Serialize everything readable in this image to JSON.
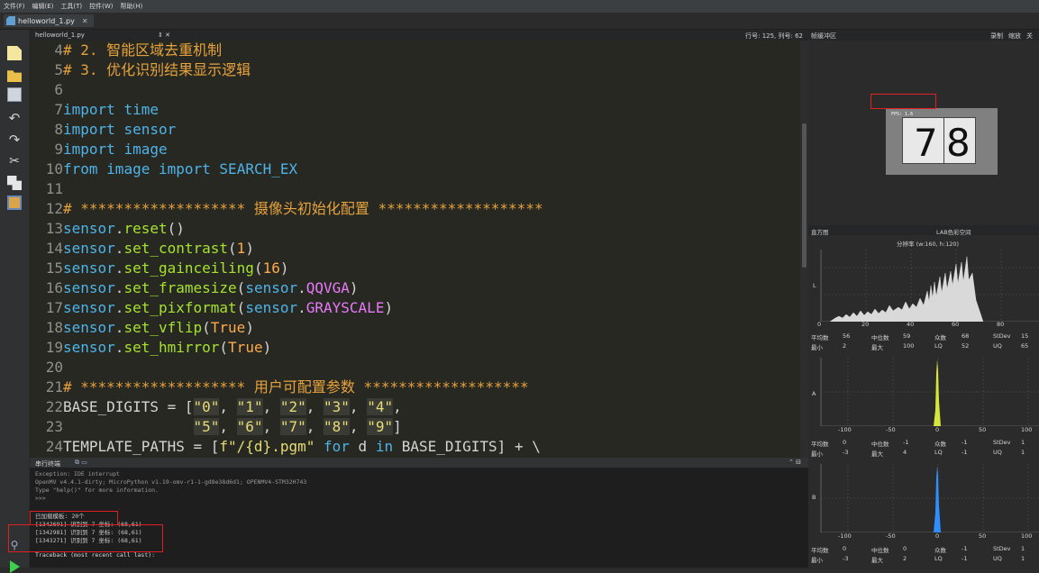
{
  "menu": [
    "文件(F)",
    "编辑(E)",
    "工具(T)",
    "控件(W)",
    "帮助(H)"
  ],
  "tab": {
    "name": "helloworld_1.py",
    "close": "✕"
  },
  "editor_header": {
    "file": "helloworld_1.py",
    "controls": "⇕ ✕",
    "position": "行号: 125, 列号: 62"
  },
  "code_lines": [
    {
      "n": "4",
      "t": [
        {
          "c": "cm",
          "s": "# 2. 智能区域去重机制"
        }
      ]
    },
    {
      "n": "5",
      "t": [
        {
          "c": "cm",
          "s": "# 3. 优化识别结果显示逻辑"
        }
      ]
    },
    {
      "n": "6",
      "t": []
    },
    {
      "n": "7",
      "t": [
        {
          "c": "kw",
          "s": "import"
        },
        {
          "c": "pl",
          "s": " "
        },
        {
          "c": "mod",
          "s": "time"
        }
      ]
    },
    {
      "n": "8",
      "t": [
        {
          "c": "kw",
          "s": "import"
        },
        {
          "c": "pl",
          "s": " "
        },
        {
          "c": "mod",
          "s": "sensor"
        }
      ]
    },
    {
      "n": "9",
      "t": [
        {
          "c": "kw",
          "s": "import"
        },
        {
          "c": "pl",
          "s": " "
        },
        {
          "c": "mod",
          "s": "image"
        }
      ]
    },
    {
      "n": "10",
      "t": [
        {
          "c": "kw",
          "s": "from"
        },
        {
          "c": "pl",
          "s": " "
        },
        {
          "c": "mod",
          "s": "image"
        },
        {
          "c": "pl",
          "s": " "
        },
        {
          "c": "kw",
          "s": "import"
        },
        {
          "c": "pl",
          "s": " "
        },
        {
          "c": "mod",
          "s": "SEARCH_EX"
        }
      ]
    },
    {
      "n": "11",
      "t": []
    },
    {
      "n": "12",
      "t": [
        {
          "c": "cm",
          "s": "# ******************* 摄像头初始化配置 *******************"
        }
      ]
    },
    {
      "n": "13",
      "t": [
        {
          "c": "kw",
          "s": "sensor"
        },
        {
          "c": "pl",
          "s": "."
        },
        {
          "c": "fn",
          "s": "reset"
        },
        {
          "c": "pl",
          "s": "()"
        }
      ]
    },
    {
      "n": "14",
      "t": [
        {
          "c": "kw",
          "s": "sensor"
        },
        {
          "c": "pl",
          "s": "."
        },
        {
          "c": "fn",
          "s": "set_contrast"
        },
        {
          "c": "pl",
          "s": "("
        },
        {
          "c": "num",
          "s": "1"
        },
        {
          "c": "pl",
          "s": ")"
        }
      ]
    },
    {
      "n": "15",
      "t": [
        {
          "c": "kw",
          "s": "sensor"
        },
        {
          "c": "pl",
          "s": "."
        },
        {
          "c": "fn",
          "s": "set_gainceiling"
        },
        {
          "c": "pl",
          "s": "("
        },
        {
          "c": "num",
          "s": "16"
        },
        {
          "c": "pl",
          "s": ")"
        }
      ]
    },
    {
      "n": "16",
      "t": [
        {
          "c": "kw",
          "s": "sensor"
        },
        {
          "c": "pl",
          "s": "."
        },
        {
          "c": "fn",
          "s": "set_framesize"
        },
        {
          "c": "pl",
          "s": "("
        },
        {
          "c": "kw",
          "s": "sensor"
        },
        {
          "c": "pl",
          "s": "."
        },
        {
          "c": "cnst",
          "s": "QQVGA"
        },
        {
          "c": "pl",
          "s": ")"
        }
      ]
    },
    {
      "n": "17",
      "t": [
        {
          "c": "kw",
          "s": "sensor"
        },
        {
          "c": "pl",
          "s": "."
        },
        {
          "c": "fn",
          "s": "set_pixformat"
        },
        {
          "c": "pl",
          "s": "("
        },
        {
          "c": "kw",
          "s": "sensor"
        },
        {
          "c": "pl",
          "s": "."
        },
        {
          "c": "cnst",
          "s": "GRAYSCALE"
        },
        {
          "c": "pl",
          "s": ")"
        }
      ]
    },
    {
      "n": "18",
      "t": [
        {
          "c": "kw",
          "s": "sensor"
        },
        {
          "c": "pl",
          "s": "."
        },
        {
          "c": "fn",
          "s": "set_vflip"
        },
        {
          "c": "pl",
          "s": "("
        },
        {
          "c": "num",
          "s": "True"
        },
        {
          "c": "pl",
          "s": ")"
        }
      ]
    },
    {
      "n": "19",
      "t": [
        {
          "c": "kw",
          "s": "sensor"
        },
        {
          "c": "pl",
          "s": "."
        },
        {
          "c": "fn",
          "s": "set_hmirror"
        },
        {
          "c": "pl",
          "s": "("
        },
        {
          "c": "num",
          "s": "True"
        },
        {
          "c": "pl",
          "s": ")"
        }
      ]
    },
    {
      "n": "20",
      "t": []
    },
    {
      "n": "21",
      "t": [
        {
          "c": "cm",
          "s": "# ******************* 用户可配置参数 *******************"
        }
      ]
    },
    {
      "n": "22",
      "t": [
        {
          "c": "pl",
          "s": "BASE_DIGITS = ["
        },
        {
          "c": "strbg",
          "s": "\"0\""
        },
        {
          "c": "pl",
          "s": ", "
        },
        {
          "c": "strbg",
          "s": "\"1\""
        },
        {
          "c": "pl",
          "s": ", "
        },
        {
          "c": "strbg",
          "s": "\"2\""
        },
        {
          "c": "pl",
          "s": ", "
        },
        {
          "c": "strbg",
          "s": "\"3\""
        },
        {
          "c": "pl",
          "s": ", "
        },
        {
          "c": "strbg",
          "s": "\"4\""
        },
        {
          "c": "pl",
          "s": ","
        }
      ]
    },
    {
      "n": "23",
      "t": [
        {
          "c": "pl",
          "s": "               "
        },
        {
          "c": "strbg",
          "s": "\"5\""
        },
        {
          "c": "pl",
          "s": ", "
        },
        {
          "c": "strbg",
          "s": "\"6\""
        },
        {
          "c": "pl",
          "s": ", "
        },
        {
          "c": "strbg",
          "s": "\"7\""
        },
        {
          "c": "pl",
          "s": ", "
        },
        {
          "c": "strbg",
          "s": "\"8\""
        },
        {
          "c": "pl",
          "s": ", "
        },
        {
          "c": "strbg",
          "s": "\"9\""
        },
        {
          "c": "pl",
          "s": "]"
        }
      ]
    },
    {
      "n": "24",
      "t": [
        {
          "c": "pl",
          "s": "TEMPLATE_PATHS = ["
        },
        {
          "c": "str",
          "s": "f\"/{d}.pgm\""
        },
        {
          "c": "pl",
          "s": " "
        },
        {
          "c": "kw",
          "s": "for"
        },
        {
          "c": "pl",
          "s": " d "
        },
        {
          "c": "kw",
          "s": "in"
        },
        {
          "c": "pl",
          "s": " BASE_DIGITS] + \\"
        }
      ]
    }
  ],
  "terminal_header": "串行终端",
  "terminal_lines": [
    "Exception: IDE interrupt",
    "OpenMV v4.4.1-dirty; MicroPython v1.19-omv-r1-1-gd8e38d6d1; OPENMV4-STM32H743",
    "Type \"help()\" for more information.",
    ">>>",
    "",
    "已加载模板: 20个",
    "[1342691] 识别到 7 坐标: (68,61)",
    "[1342981] 识别到 7 坐标: (68,61)",
    "[1343271] 识别到 7 坐标: (68,61)",
    "",
    "Traceback (most recent call last):"
  ],
  "framebuffer": {
    "title": "帧缓冲区",
    "record": "录制",
    "zoom": "缩放",
    "disable": "关",
    "fps_text": "FPS: 1.6",
    "digits": [
      "7",
      "8"
    ]
  },
  "histogram": {
    "label": "直方图",
    "colorspace": "LAB色彩空间",
    "resolution": "分辨率 (w:160, h:120)",
    "L": {
      "axis_label": "L",
      "ticks": [
        "0",
        "20",
        "40",
        "60",
        "80"
      ],
      "stats": {
        "mean_label": "平均数",
        "mean": "56",
        "median_label": "中位数",
        "median": "59",
        "mode_label": "众数",
        "mode": "68",
        "stdev_label": "StDev",
        "stdev": "15",
        "min_label": "最小",
        "min": "2",
        "max_label": "最大",
        "max": "100",
        "lq_label": "LQ",
        "lq": "52",
        "uq_label": "UQ",
        "uq": "65"
      }
    },
    "A": {
      "axis_label": "A",
      "ticks": [
        "-100",
        "-50",
        "0",
        "50",
        "100"
      ],
      "stats": {
        "mean_label": "平均数",
        "mean": "0",
        "median_label": "中位数",
        "median": "-1",
        "mode_label": "众数",
        "mode": "-1",
        "stdev_label": "StDev",
        "stdev": "1",
        "min_label": "最小",
        "min": "-3",
        "max_label": "最大",
        "max": "4",
        "lq_label": "LQ",
        "lq": "-1",
        "uq_label": "UQ",
        "uq": "1"
      }
    },
    "B": {
      "axis_label": "B",
      "ticks": [
        "-100",
        "-50",
        "0",
        "50",
        "100"
      ],
      "stats": {
        "mean_label": "平均数",
        "mean": "0",
        "median_label": "中位数",
        "median": "0",
        "mode_label": "众数",
        "mode": "-1",
        "stdev_label": "StDev",
        "stdev": "1",
        "min_label": "最小",
        "min": "-3",
        "max_label": "最大",
        "max": "2",
        "lq_label": "LQ",
        "lq": "-1",
        "uq_label": "UQ",
        "uq": "1"
      }
    }
  },
  "colors": {
    "editor_bg": "#272822",
    "comment": "#e6a23c",
    "keyword": "#4fb3e8",
    "function": "#a6e22e",
    "number": "#ffa94d",
    "constant": "#e879f9",
    "hist_L": "#d9d9d9",
    "hist_A": "#d7e63a",
    "hist_B": "#2f8fff",
    "annotation_box": "#e02020"
  }
}
